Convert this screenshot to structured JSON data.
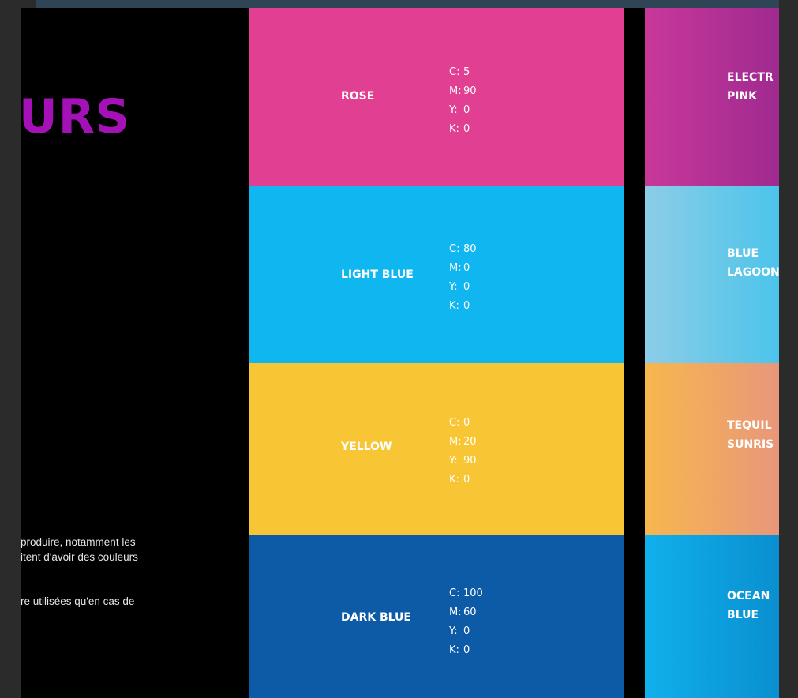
{
  "heading": {
    "mark": ":",
    "title": "URS"
  },
  "paragraphs": [
    [
      "produire, notamment les",
      "itent d'avoir des couleurs"
    ],
    [
      "re utilisées qu'en cas de"
    ]
  ],
  "swatches": [
    {
      "name": "ROSE",
      "color": "#e03f92",
      "cmyk": [
        [
          "C:",
          "5"
        ],
        [
          "M:",
          "90"
        ],
        [
          "Y:",
          "0"
        ],
        [
          "K:",
          "0"
        ]
      ]
    },
    {
      "name": "LIGHT BLUE",
      "color": "#0fb6ef",
      "cmyk": [
        [
          "C:",
          "80"
        ],
        [
          "M:",
          "0"
        ],
        [
          "Y:",
          "0"
        ],
        [
          "K:",
          "0"
        ]
      ]
    },
    {
      "name": "YELLOW",
      "color": "#f8c634",
      "cmyk": [
        [
          "C:",
          "0"
        ],
        [
          "M:",
          "20"
        ],
        [
          "Y:",
          "90"
        ],
        [
          "K:",
          "0"
        ]
      ]
    },
    {
      "name": "DARK BLUE",
      "color": "#0d5aa6",
      "cmyk": [
        [
          "C:",
          "100"
        ],
        [
          "M:",
          "60"
        ],
        [
          "Y:",
          "0"
        ],
        [
          "K:",
          "0"
        ]
      ]
    }
  ],
  "gradients": [
    {
      "lines": [
        "ELECTR",
        "PINK"
      ],
      "from": "#c8389a",
      "to": "#a02a90"
    },
    {
      "lines": [
        "BLUE",
        "LAGOON"
      ],
      "from": "#8ccde8",
      "to": "#4cc4ea"
    },
    {
      "lines": [
        "TEQUIL",
        "SUNRIS"
      ],
      "from": "#f7b74e",
      "to": "#e8977a"
    },
    {
      "lines": [
        "OCEAN",
        "BLUE"
      ],
      "from": "#10b0ec",
      "to": "#0a8fd0"
    }
  ]
}
